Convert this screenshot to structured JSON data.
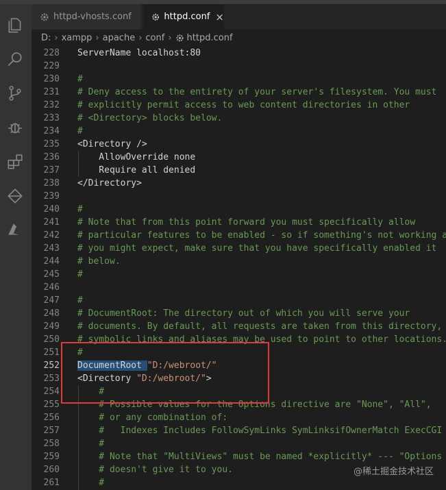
{
  "tabs": [
    {
      "label": "httpd-vhosts.conf",
      "active": false
    },
    {
      "label": "httpd.conf",
      "active": true,
      "close": "×"
    }
  ],
  "breadcrumb": [
    "D:",
    "xampp",
    "apache",
    "conf",
    "httpd.conf"
  ],
  "breadcrumb_sep": "›",
  "activity_icons": [
    "explorer-icon",
    "search-icon",
    "source-control-icon",
    "debug-icon",
    "extensions-icon",
    "remote-icon",
    "azure-icon"
  ],
  "lines": [
    {
      "n": "228",
      "text": "ServerName localhost:80",
      "type": "plain"
    },
    {
      "n": "229",
      "text": "",
      "type": "plain"
    },
    {
      "n": "230",
      "text": "#",
      "type": "comment"
    },
    {
      "n": "231",
      "text": "# Deny access to the entirety of your server's filesystem. You must",
      "type": "comment"
    },
    {
      "n": "232",
      "text": "# explicitly permit access to web content directories in other",
      "type": "comment"
    },
    {
      "n": "233",
      "text": "# <Directory> blocks below.",
      "type": "comment"
    },
    {
      "n": "234",
      "text": "#",
      "type": "comment"
    },
    {
      "n": "235",
      "text": "<Directory />",
      "type": "plain"
    },
    {
      "n": "236",
      "text": "    AllowOverride none",
      "type": "plain"
    },
    {
      "n": "237",
      "text": "    Require all denied",
      "type": "plain"
    },
    {
      "n": "238",
      "text": "</Directory>",
      "type": "plain"
    },
    {
      "n": "239",
      "text": "",
      "type": "plain"
    },
    {
      "n": "240",
      "text": "#",
      "type": "comment"
    },
    {
      "n": "241",
      "text": "# Note that from this point forward you must specifically allow",
      "type": "comment"
    },
    {
      "n": "242",
      "text": "# particular features to be enabled - so if something's not working as",
      "type": "comment"
    },
    {
      "n": "243",
      "text": "# you might expect, make sure that you have specifically enabled it",
      "type": "comment"
    },
    {
      "n": "244",
      "text": "# below.",
      "type": "comment"
    },
    {
      "n": "245",
      "text": "#",
      "type": "comment"
    },
    {
      "n": "246",
      "text": "",
      "type": "plain"
    },
    {
      "n": "247",
      "text": "#",
      "type": "comment"
    },
    {
      "n": "248",
      "text": "# DocumentRoot: The directory out of which you will serve your",
      "type": "comment"
    },
    {
      "n": "249",
      "text": "# documents. By default, all requests are taken from this directory, b",
      "type": "comment"
    },
    {
      "n": "250",
      "text": "# symbolic links and aliases may be used to point to other locations.",
      "type": "comment"
    },
    {
      "n": "251",
      "text": "#",
      "type": "comment"
    },
    {
      "n": "252",
      "parts": [
        {
          "t": "DocumentRoot",
          "c": "sel"
        },
        {
          "t": " ",
          "c": "sel"
        },
        {
          "t": "\"D:/webroot/\"",
          "c": "c-string"
        }
      ],
      "type": "parts",
      "current": true
    },
    {
      "n": "253",
      "parts": [
        {
          "t": "<Directory ",
          "c": ""
        },
        {
          "t": "\"D:/webroot/\"",
          "c": "c-string"
        },
        {
          "t": ">",
          "c": ""
        }
      ],
      "type": "parts"
    },
    {
      "n": "254",
      "text": "    #",
      "type": "comment"
    },
    {
      "n": "255",
      "text": "    # Possible values for the Options directive are \"None\", \"All\",",
      "type": "comment"
    },
    {
      "n": "256",
      "text": "    # or any combination of:",
      "type": "comment"
    },
    {
      "n": "257",
      "text": "    #   Indexes Includes FollowSymLinks SymLinksifOwnerMatch ExecCGI M",
      "type": "comment"
    },
    {
      "n": "258",
      "text": "    #",
      "type": "comment"
    },
    {
      "n": "259",
      "text": "    # Note that \"MultiViews\" must be named *explicitly* --- \"Options A",
      "type": "comment"
    },
    {
      "n": "260",
      "text": "    # doesn't give it to you.",
      "type": "comment"
    },
    {
      "n": "261",
      "text": "    #",
      "type": "comment"
    }
  ],
  "watermark": "@稀土掘金技术社区",
  "colors": {
    "comment": "#6a9955",
    "string": "#ce9178",
    "annotation_box": "#e03a3a"
  }
}
